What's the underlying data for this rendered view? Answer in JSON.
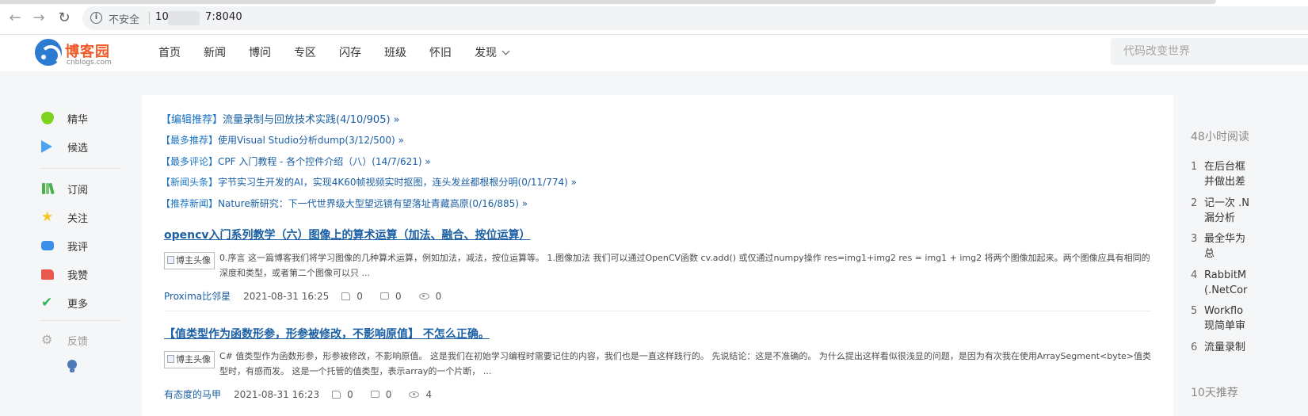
{
  "browser": {
    "insecure_label": "不安全",
    "url_prefix": "10",
    "url_suffix": "7:8040"
  },
  "header": {
    "logo_name": "博客园",
    "logo_domain": "cnblogs.com",
    "nav": [
      "首页",
      "新闻",
      "博问",
      "专区",
      "闪存",
      "班级",
      "怀旧",
      "发现"
    ],
    "search_placeholder": "代码改变世界"
  },
  "sidebar": {
    "items": [
      {
        "label": "精华",
        "icon": "gem-icon"
      },
      {
        "label": "候选",
        "icon": "play-icon"
      },
      {
        "label": "订阅",
        "icon": "books-icon"
      },
      {
        "label": "关注",
        "icon": "star-icon"
      },
      {
        "label": "我评",
        "icon": "comment-icon"
      },
      {
        "label": "我赞",
        "icon": "thumb-icon"
      },
      {
        "label": "更多",
        "icon": "check-icon"
      }
    ],
    "feedback_label": "反馈",
    "colors": {
      "gem": "#7ed321",
      "play": "#4aa3f0",
      "star": "#f7c51e",
      "comment": "#3c8ee8",
      "thumb": "#e9594f",
      "check": "#31b45a"
    }
  },
  "recommendations": [
    {
      "tag": "【编辑推荐】",
      "title": "流量录制与回放技术实践(4/10/905) »"
    },
    {
      "tag": "【最多推荐】",
      "title": "使用Visual Studio分析dump(3/12/500) »"
    },
    {
      "tag": "【最多评论】",
      "title": "CPF 入门教程 - 各个控件介绍（八）(14/7/621) »"
    },
    {
      "tag": "【新闻头条】",
      "title": "字节实习生开发的AI，实现4K60帧视频实时抠图，连头发丝都根根分明(0/11/774) »"
    },
    {
      "tag": "【推荐新闻】",
      "title": "Nature新研究：下一代世界级大型望远镜有望落址青藏高原(0/16/885) »"
    }
  ],
  "posts": [
    {
      "title": "opencv入门系列教学（六）图像上的算术运算（加法、融合、按位运算）",
      "avatar_alt": "博主头像",
      "summary": "0.序言 这一篇博客我们将学习图像的几种算术运算，例如加法，减法，按位运算等。 1.图像加法 我们可以通过OpenCV函数 cv.add() 或仅通过numpy操作 res=img1+img2 res = img1 + img2 将两个图像加起来。两个图像应具有相同的深度和类型，或者第二个图像可以只 ...",
      "author": "Proxima比邻星",
      "date": "2021-08-31 16:25",
      "likes": "0",
      "comments": "0",
      "views": "0"
    },
    {
      "title": "【值类型作为函数形参，形参被修改，不影响原值】 不怎么正确。",
      "avatar_alt": "博主头像",
      "summary": "C# 值类型作为函数形参，形参被修改，不影响原值。 这是我们在初始学习编程时需要记住的内容，我们也是一直这样践行的。 先说结论：这是不准确的。 为什么提出这样看似很浅显的问题，是因为有次我在使用ArraySegment<byte>值类型时，有感而发。 这是一个托管的值类型，表示array的一个片断， ...",
      "author": "有态度的马甲",
      "date": "2021-08-31 16:23",
      "likes": "0",
      "comments": "0",
      "views": "4"
    }
  ],
  "right": {
    "heading": "48小时阅读",
    "items": [
      {
        "num": "1",
        "line1": "在后台框",
        "line2": "并做出差"
      },
      {
        "num": "2",
        "line1": "记一次 .N",
        "line2": "漏分析"
      },
      {
        "num": "3",
        "line1": "最全华为",
        "line2": "总"
      },
      {
        "num": "4",
        "line1": "RabbitM",
        "line2": "(.NetCor"
      },
      {
        "num": "5",
        "line1": "Workflo",
        "line2": "现简单审"
      },
      {
        "num": "6",
        "line1": "流量录制",
        "line2": ""
      }
    ],
    "heading2": "10天推荐"
  }
}
